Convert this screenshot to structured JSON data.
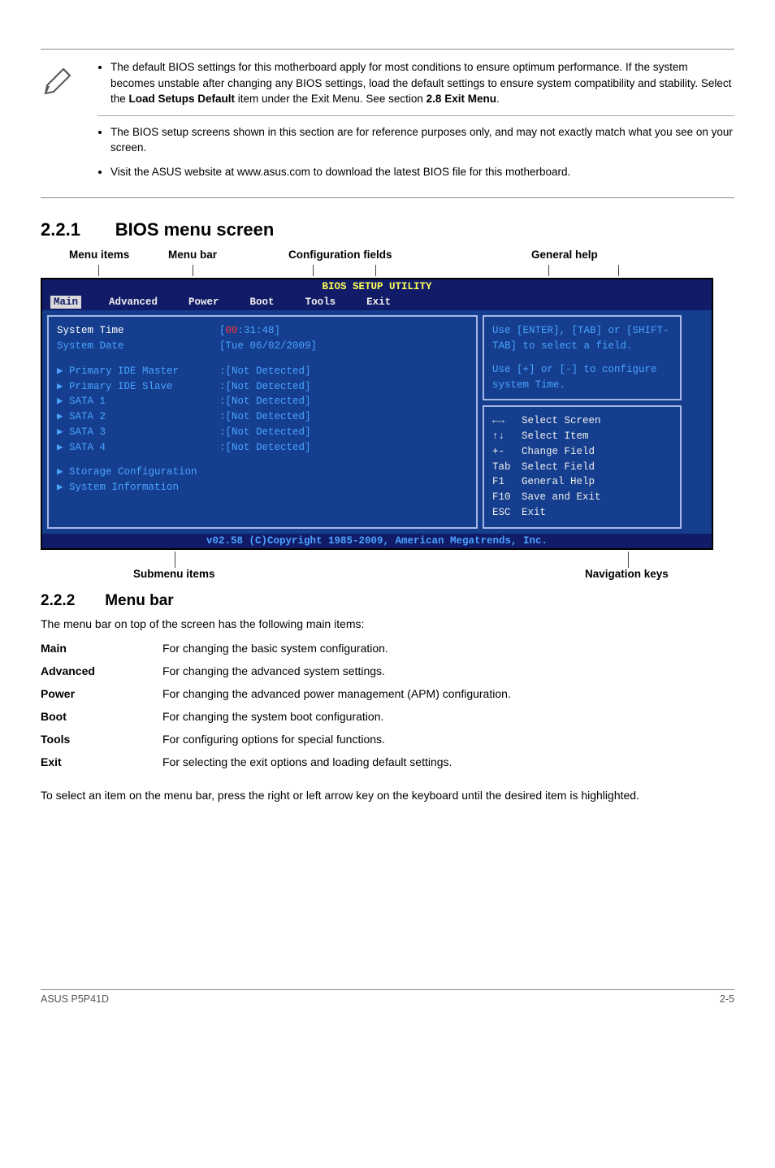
{
  "notes": {
    "item1_prefix": "The default BIOS settings for this motherboard apply for most conditions to ensure optimum performance. If the system becomes unstable after changing any BIOS settings, load the default settings to ensure system compatibility and stability. Select the ",
    "item1_bold1": "Load Setups Default",
    "item1_mid": " item under the Exit Menu. See section ",
    "item1_bold2": "2.8 Exit Menu",
    "item1_suffix": ".",
    "item2": "The BIOS setup screens shown in this section are for reference purposes only, and may not exactly match what you see on your screen.",
    "item3": "Visit the ASUS website at www.asus.com to download the latest BIOS file for this motherboard."
  },
  "sections": {
    "s221": "2.2.1       BIOS menu screen",
    "s222": "2.2.2       Menu bar"
  },
  "toplabels": {
    "menu_items": "Menu items",
    "menu_bar": "Menu bar",
    "config_fields": "Configuration fields",
    "general_help": "General help"
  },
  "bottomlabels": {
    "submenu": "Submenu items",
    "navkeys": "Navigation keys"
  },
  "bios": {
    "title": "BIOS SETUP UTILITY",
    "menu": {
      "main": "Main",
      "advanced": "Advanced",
      "power": "Power",
      "boot": "Boot",
      "tools": "Tools",
      "exit": "Exit"
    },
    "left": {
      "sys_time_label": "System Time",
      "sys_time_val_pre": "[",
      "sys_time_val_hl": "00",
      "sys_time_val_post": ":31:48]",
      "sys_date_label": "System Date",
      "sys_date_val": "[Tue 06/02/2009]",
      "pim_label": "Primary IDE Master",
      "pim_val": ":[Not Detected]",
      "pis_label": "Primary IDE Slave",
      "pis_val": ":[Not Detected]",
      "s1_label": "SATA 1",
      "s1_val": ":[Not Detected]",
      "s2_label": "SATA 2",
      "s2_val": ":[Not Detected]",
      "s3_label": "SATA 3",
      "s3_val": ":[Not Detected]",
      "s4_label": "SATA 4",
      "s4_val": ":[Not Detected]",
      "storage": "Storage Configuration",
      "sysinfo": "System Information"
    },
    "help": {
      "line1": "Use [ENTER], [TAB] or [SHIFT-TAB] to select a field.",
      "line2": "Use [+] or [-] to configure system Time."
    },
    "nav": {
      "k1": "←→",
      "d1": "Select Screen",
      "k2": "↑↓",
      "d2": "Select Item",
      "k3": "+-",
      "d3": "Change Field",
      "k4": "Tab",
      "d4": "Select Field",
      "k5": "F1",
      "d5": "General Help",
      "k6": "F10",
      "d6": "Save and Exit",
      "k7": "ESC",
      "d7": "Exit"
    },
    "footer": "v02.58 (C)Copyright 1985-2009, American Megatrends, Inc."
  },
  "menubar_intro": "The menu bar on top of the screen has the following main items:",
  "descs": {
    "main_k": "Main",
    "main_v": "For changing the basic system configuration.",
    "adv_k": "Advanced",
    "adv_v": "For changing the advanced system settings.",
    "power_k": "Power",
    "power_v": "For changing the advanced power management (APM) configuration.",
    "boot_k": "Boot",
    "boot_v": "For changing the system boot configuration.",
    "tools_k": "Tools",
    "tools_v": "For configuring options for special functions.",
    "exit_k": "Exit",
    "exit_v": "For selecting the exit options and loading default settings."
  },
  "after_table": "To select an item on the menu bar, press the right or left arrow key on the keyboard until the desired item is highlighted.",
  "footer": {
    "left": "ASUS P5P41D",
    "right": "2-5"
  }
}
